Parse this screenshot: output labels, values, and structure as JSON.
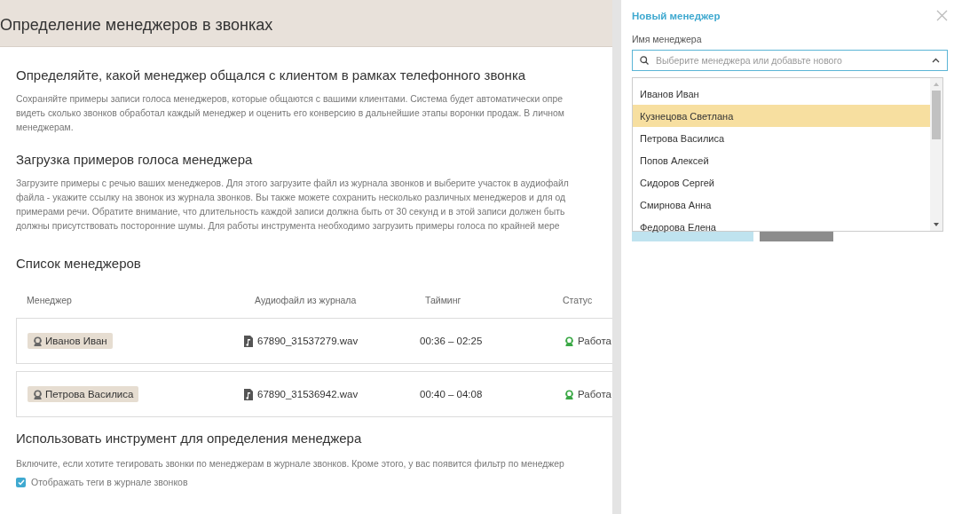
{
  "page": {
    "title": "Определение менеджеров в звонках",
    "sections": [
      {
        "heading": "Определяйте, какой менеджер общался с клиентом в рамках телефонного звонка",
        "lines": [
          "Сохраняйте примеры записи голоса менеджеров, которые общаются с вашими клиентами. Система будет автоматически опре",
          "видеть сколько звонков обработал каждый менеджер и оценить его конверсию в дальнейшие этапы воронки продаж. В личном",
          "менеджерам."
        ]
      },
      {
        "heading": "Загрузка примеров голоса менеджера",
        "lines": [
          "Загрузите примеры с речью ваших менеджеров. Для этого загрузите файл из журнала звонков и выберите участок в аудиофайл",
          "файла - укажите ссылку на звонок из журнала звонков. Вы также можете сохранить несколько различных менеджеров и для од",
          "примерами речи. Обратите внимание, что длительность каждой записи должна быть от 30 секунд и в этой записи должен быть",
          "должны присутствовать посторонние шумы. Для работы инструмента необходимо загрузить примеры голоса по крайней мере"
        ]
      }
    ],
    "managers": {
      "heading": "Список менеджеров",
      "columns": [
        "Менеджер",
        "Аудиофайл из журнала",
        "Тайминг",
        "Статус"
      ],
      "rows": [
        {
          "manager": "Иванов Иван",
          "file": "67890_31537279.wav",
          "timing": "00:36 – 02:25",
          "status": "Работа"
        },
        {
          "manager": "Петрова Василиса",
          "file": "67890_31536942.wav",
          "timing": "00:40 – 04:08",
          "status": "Работа"
        }
      ]
    },
    "tool": {
      "heading": "Использовать инструмент для определения менеджера",
      "text": "Включите, если хотите тегировать звонки по менеджерам в журнале звонков. Кроме этого, у вас появится фильтр по менеджер",
      "checkbox": {
        "label": "Отображать теги в журнале звонков",
        "checked": true
      }
    }
  },
  "panel": {
    "title": "Новый менеджер",
    "field_label": "Имя менеджера",
    "placeholder": "Выберите менеджера или добавьте нового",
    "expanded": true,
    "options": [
      {
        "label": "Иванов Иван",
        "selected": false
      },
      {
        "label": "Кузнецова Светлана",
        "selected": true
      },
      {
        "label": "Петрова Василиса",
        "selected": false
      },
      {
        "label": "Попов Алексей",
        "selected": false
      },
      {
        "label": "Сидоров Сергей",
        "selected": false
      },
      {
        "label": "Смирнова Анна",
        "selected": false
      },
      {
        "label": "Федорова Елена",
        "selected": false
      }
    ]
  }
}
